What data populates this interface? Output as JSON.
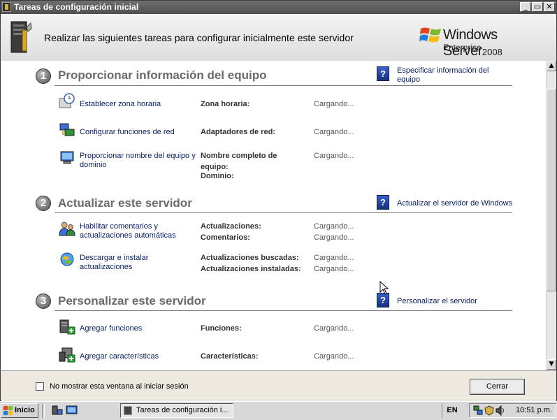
{
  "window": {
    "title": "Tareas de configuración inicial",
    "min": "_",
    "max": "▭",
    "close": "✕"
  },
  "header": {
    "headline": "Realizar las siguientes tareas para configurar inicialmente este servidor",
    "brand_name": "Windows Server",
    "brand_version": "2008",
    "brand_edition": "Enterprise"
  },
  "sections": [
    {
      "number": "1",
      "title": "Proporcionar información del equipo",
      "link": "Especificar información del equipo",
      "tasks": [
        {
          "label": "Establecer zona horaria",
          "props": [
            {
              "name": "Zona horaria:",
              "value": "Cargando..."
            }
          ]
        },
        {
          "label": "Configurar funciones de red",
          "props": [
            {
              "name": "Adaptadores de red:",
              "value": "Cargando..."
            }
          ]
        },
        {
          "label": "Proporcionar nombre del equipo y dominio",
          "props": [
            {
              "name": "Nombre completo de equipo:",
              "value": "Cargando..."
            },
            {
              "name": "Dominio:",
              "value": ""
            }
          ]
        }
      ]
    },
    {
      "number": "2",
      "title": "Actualizar este servidor",
      "link": "Actualizar el servidor de Windows",
      "tasks": [
        {
          "label": "Habilitar comentarios y actualizaciones automáticas",
          "props": [
            {
              "name": "Actualizaciones:",
              "value": "Cargando..."
            },
            {
              "name": "Comentarios:",
              "value": "Cargando..."
            }
          ]
        },
        {
          "label": "Descargar e instalar actualizaciones",
          "props": [
            {
              "name": "Actualizaciones buscadas:",
              "value": "Cargando..."
            },
            {
              "name": "Actualizaciones instaladas:",
              "value": "Cargando..."
            }
          ]
        }
      ]
    },
    {
      "number": "3",
      "title": "Personalizar este servidor",
      "link": "Personalizar el servidor",
      "tasks": [
        {
          "label": "Agregar funciones",
          "props": [
            {
              "name": "Funciones:",
              "value": "Cargando..."
            }
          ]
        },
        {
          "label": "Agregar características",
          "props": [
            {
              "name": "Características:",
              "value": "Cargando..."
            }
          ]
        }
      ]
    }
  ],
  "footer": {
    "checkbox_label": "No mostrar esta ventana al iniciar sesión",
    "checkbox_checked": false,
    "close_button": "Cerrar"
  },
  "taskbar": {
    "start_label": "Inicio",
    "task_button": "Tareas de configuración i...",
    "language": "EN",
    "clock": "10:51 p.m."
  },
  "colors": {
    "title_bar": "#5a5a5a",
    "section_title": "#6a6a6a",
    "link_text": "#0b2266",
    "help_icon": "#2a4cb4"
  },
  "icons": {
    "tasks": [
      "clock-icon",
      "network-icon",
      "computer-icon",
      "feedback-icon",
      "update-icon",
      "add-roles-icon",
      "add-features-icon"
    ],
    "links": "help-book-icon"
  }
}
